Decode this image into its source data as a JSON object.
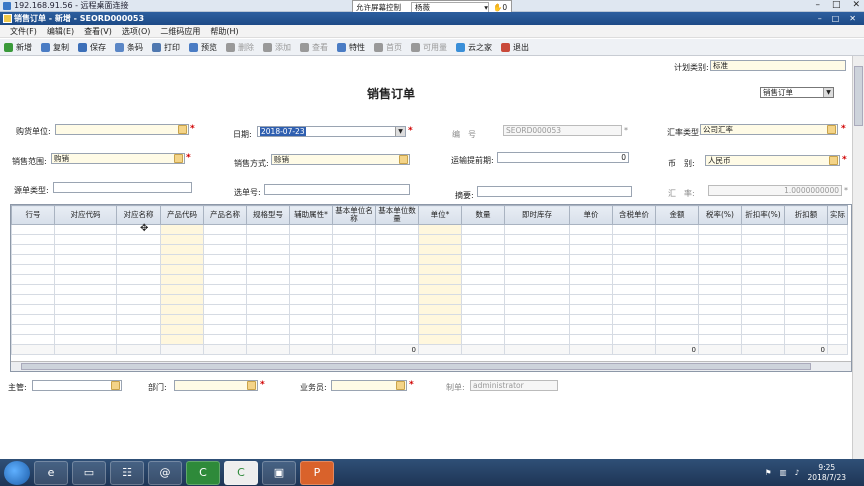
{
  "remote": {
    "title": "192.168.91.56 - 远程桌面连接",
    "control_label": "允许屏幕控制",
    "control_value": "杨薇",
    "control_count": "0"
  },
  "app": {
    "title": "销售订单 - 新增 - SEORD000053"
  },
  "menu": [
    "文件(F)",
    "编辑(E)",
    "查看(V)",
    "选项(O)",
    "二维码应用",
    "帮助(H)"
  ],
  "toolbar": [
    {
      "label": "新增",
      "icon": "new-icon",
      "color": "#3a9a3a",
      "enabled": true
    },
    {
      "label": "复制",
      "icon": "copy-icon",
      "color": "#4a7cc4",
      "enabled": true
    },
    {
      "label": "保存",
      "icon": "save-icon",
      "color": "#3c6fb8",
      "enabled": true
    },
    {
      "label": "条码",
      "icon": "barcode-icon",
      "color": "#5a86c6",
      "enabled": true
    },
    {
      "label": "打印",
      "icon": "print-icon",
      "color": "#4f78b0",
      "enabled": true
    },
    {
      "label": "预览",
      "icon": "preview-icon",
      "color": "#4a7cc4",
      "enabled": true
    },
    {
      "label": "删除",
      "icon": "delete-icon",
      "color": "#999999",
      "enabled": false
    },
    {
      "label": "添加",
      "icon": "add-row-icon",
      "color": "#999999",
      "enabled": false
    },
    {
      "label": "查看",
      "icon": "view-icon",
      "color": "#999999",
      "enabled": false
    },
    {
      "label": "特性",
      "icon": "feature-icon",
      "color": "#4a7cc4",
      "enabled": true
    },
    {
      "label": "首页",
      "icon": "first-page-icon",
      "color": "#999999",
      "enabled": false
    },
    {
      "label": "可用量",
      "icon": "stock-icon",
      "color": "#999999",
      "enabled": false
    },
    {
      "label": "云之家",
      "icon": "cloud-icon",
      "color": "#3a8fd8",
      "enabled": true
    },
    {
      "label": "退出",
      "icon": "exit-icon",
      "color": "#c94a3a",
      "enabled": true
    }
  ],
  "form": {
    "title": "销售订单",
    "plan_type_label": "计划类别:",
    "plan_type_value": "标准",
    "order_type_select": "销售订单",
    "buyer_label": "购货单位:",
    "buyer_value": "",
    "date_label": "日期:",
    "date_value": "2018-07-23",
    "number_label": "编　号",
    "number_value": "SEORD000053",
    "exchange_type_label": "汇率类型:",
    "exchange_type_value": "公司汇率",
    "sales_scope_label": "销售范围:",
    "sales_scope_value": "购销",
    "sales_mode_label": "销售方式:",
    "sales_mode_value": "赊销",
    "transport_label": "运输提前期:",
    "transport_value": "0",
    "currency_label": "币　别:",
    "currency_value": "人民币",
    "source_type_label": "源单类型:",
    "source_type_value": "",
    "select_no_label": "选单号:",
    "select_no_value": "",
    "summary_label": "摘要:",
    "summary_value": "",
    "rate_label": "汇　率:",
    "rate_value": "1.0000000000"
  },
  "grid": {
    "headers": [
      "行号",
      "对应代码",
      "对应名称",
      "产品代码",
      "产品名称",
      "规格型号",
      "辅助属性*",
      "基本单位名称",
      "基本单位数量",
      "单位*",
      "数量",
      "即时库存",
      "单价",
      "含税单价",
      "金额",
      "税率(%)",
      "折扣率(%)",
      "折扣额",
      "实际"
    ],
    "totals": {
      "basic_qty": "0",
      "amount": "0",
      "discount": "0"
    }
  },
  "footer": {
    "manager_label": "主管:",
    "manager_value": "",
    "dept_label": "部门:",
    "dept_value": "",
    "salesman_label": "业务员:",
    "salesman_value": "",
    "maker_label": "制单:",
    "maker_value": "administrator"
  },
  "taskbar": {
    "time": "9:25",
    "date": "2018/7/23"
  }
}
